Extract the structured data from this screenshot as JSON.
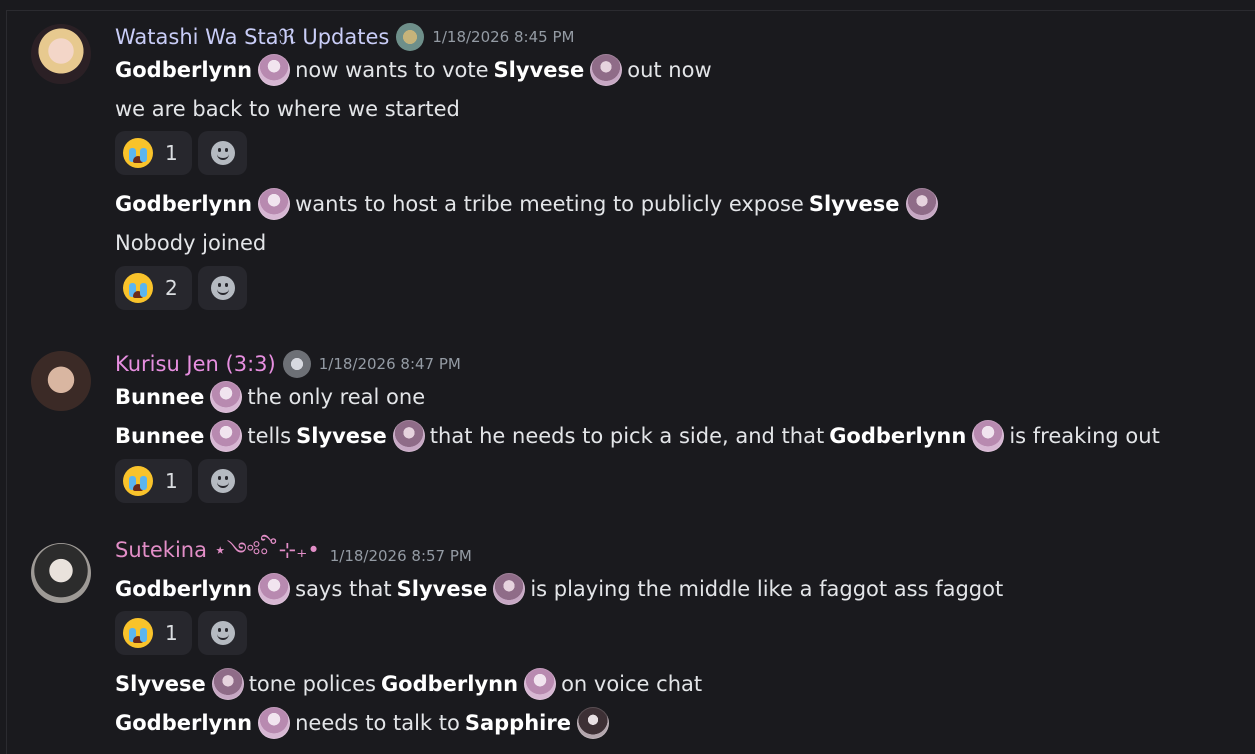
{
  "messages": [
    {
      "author": "Watashi Wa Staℜ Updates",
      "author_color": "#c9cdf7",
      "timestamp": "1/18/2026 8:45 PM",
      "lines": [
        {
          "parts": [
            {
              "bold": "Godberlynn"
            },
            {
              "text": "now wants to vote"
            },
            {
              "bold": "Slyvese"
            },
            {
              "text": "out now"
            }
          ]
        },
        {
          "parts": [
            {
              "text": "we are back to where we started"
            }
          ]
        }
      ],
      "reaction": {
        "emoji": "crying-face",
        "count": "1"
      }
    },
    {
      "lines": [
        {
          "parts": [
            {
              "bold": "Godberlynn"
            },
            {
              "text": "wants to host a tribe meeting to publicly expose"
            },
            {
              "bold": "Slyvese"
            }
          ]
        },
        {
          "parts": [
            {
              "text": "Nobody joined"
            }
          ]
        }
      ],
      "reaction": {
        "emoji": "crying-face",
        "count": "2"
      }
    },
    {
      "author": "Kurisu Jen (3:3)",
      "author_color": "#e78fe0",
      "timestamp": "1/18/2026 8:47 PM",
      "lines": [
        {
          "parts": [
            {
              "bold": "Bunnee"
            },
            {
              "text": "the only real one"
            }
          ]
        },
        {
          "parts": [
            {
              "bold": "Bunnee"
            },
            {
              "text": "tells"
            },
            {
              "bold": "Slyvese"
            },
            {
              "text": "that he needs to pick a side, and that"
            },
            {
              "bold": "Godberlynn"
            },
            {
              "text": "is freaking out"
            }
          ]
        }
      ],
      "reaction": {
        "emoji": "crying-face",
        "count": "1"
      }
    },
    {
      "author": "Sutekina ⋆༺ི༚˚⊹₊•",
      "author_color": "#e28ec7",
      "timestamp": "1/18/2026 8:57 PM",
      "lines": [
        {
          "parts": [
            {
              "bold": "Godberlynn"
            },
            {
              "text": "says that"
            },
            {
              "bold": "Slyvese"
            },
            {
              "text": "is playing the middle like a faggot ass faggot"
            }
          ]
        }
      ],
      "reaction": {
        "emoji": "crying-face",
        "count": "1"
      }
    },
    {
      "lines": [
        {
          "parts": [
            {
              "bold": "Slyvese"
            },
            {
              "text": "tone polices"
            },
            {
              "bold": "Godberlynn"
            },
            {
              "text": "on voice chat"
            }
          ]
        },
        {
          "parts": [
            {
              "bold": "Godberlynn"
            },
            {
              "text": "needs to talk to"
            },
            {
              "bold": "Sapphire"
            }
          ]
        }
      ]
    }
  ]
}
